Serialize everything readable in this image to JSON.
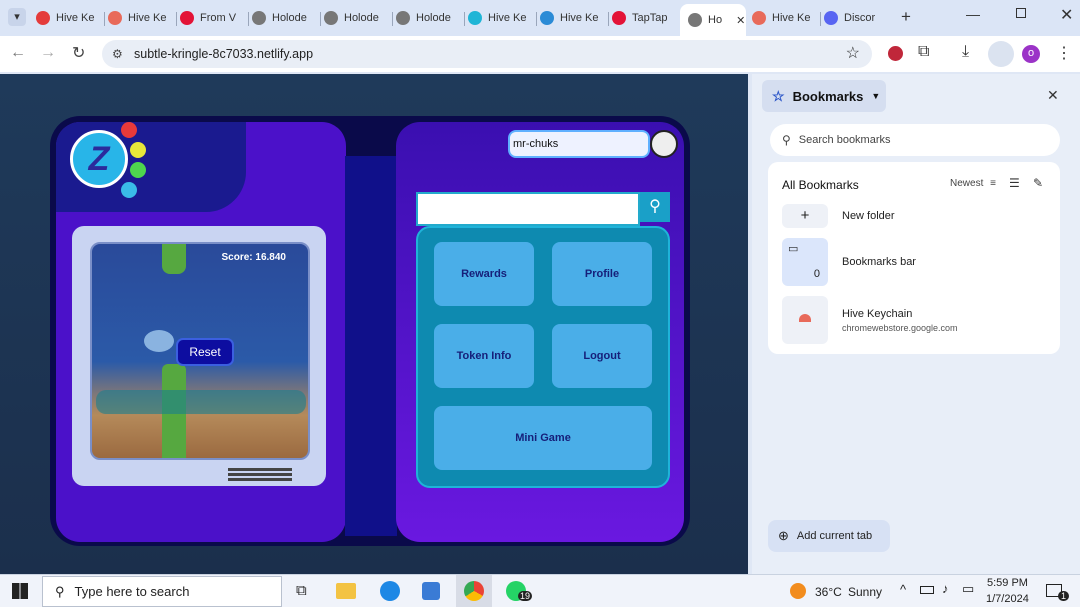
{
  "tabs": [
    {
      "label": "Hive Ke",
      "color": "#e43b3b"
    },
    {
      "label": "Hive Ke",
      "color": "#e86a5a"
    },
    {
      "label": "From V",
      "color": "#e31337"
    },
    {
      "label": "Holode",
      "color": "#777"
    },
    {
      "label": "Holode",
      "color": "#777"
    },
    {
      "label": "Holode",
      "color": "#777"
    },
    {
      "label": "Hive Ke",
      "color": "#1fb5d6"
    },
    {
      "label": "Hive Ke",
      "color": "#2b8bd6"
    },
    {
      "label": "TapTap",
      "color": "#e31337"
    },
    {
      "label": "Ho",
      "color": "#777"
    },
    {
      "label": "Hive Ke",
      "color": "#e86a5a"
    },
    {
      "label": "Discor",
      "color": "#5865f2"
    }
  ],
  "toolbar": {
    "url": "subtle-kringle-8c7033.netlify.app",
    "profile_initial": "o"
  },
  "game": {
    "username": "mr-chuks",
    "search_value": "",
    "score": "Score: 16.840",
    "reset_label": "Reset",
    "buttons": {
      "rewards": "Rewards",
      "profile": "Profile",
      "token_info": "Token Info",
      "logout": "Logout",
      "mini_game": "Mini Game"
    },
    "logo_letter": "Z"
  },
  "bookmarks": {
    "title": "Bookmarks",
    "search_placeholder": "Search bookmarks",
    "all_label": "All Bookmarks",
    "sort_label": "Newest",
    "new_folder": "New folder",
    "bookmarks_bar": "Bookmarks bar",
    "bookmarks_bar_count": "0",
    "item_title": "Hive Keychain",
    "item_url": "chromewebstore.google.com",
    "add_current_tab": "Add current tab"
  },
  "taskbar": {
    "search_placeholder": "Type here to search",
    "weather_temp": "36°C",
    "weather_desc": "Sunny",
    "time": "5:59 PM",
    "date": "1/7/2024",
    "whatsapp_badge": "19",
    "notif_badge": "1"
  }
}
